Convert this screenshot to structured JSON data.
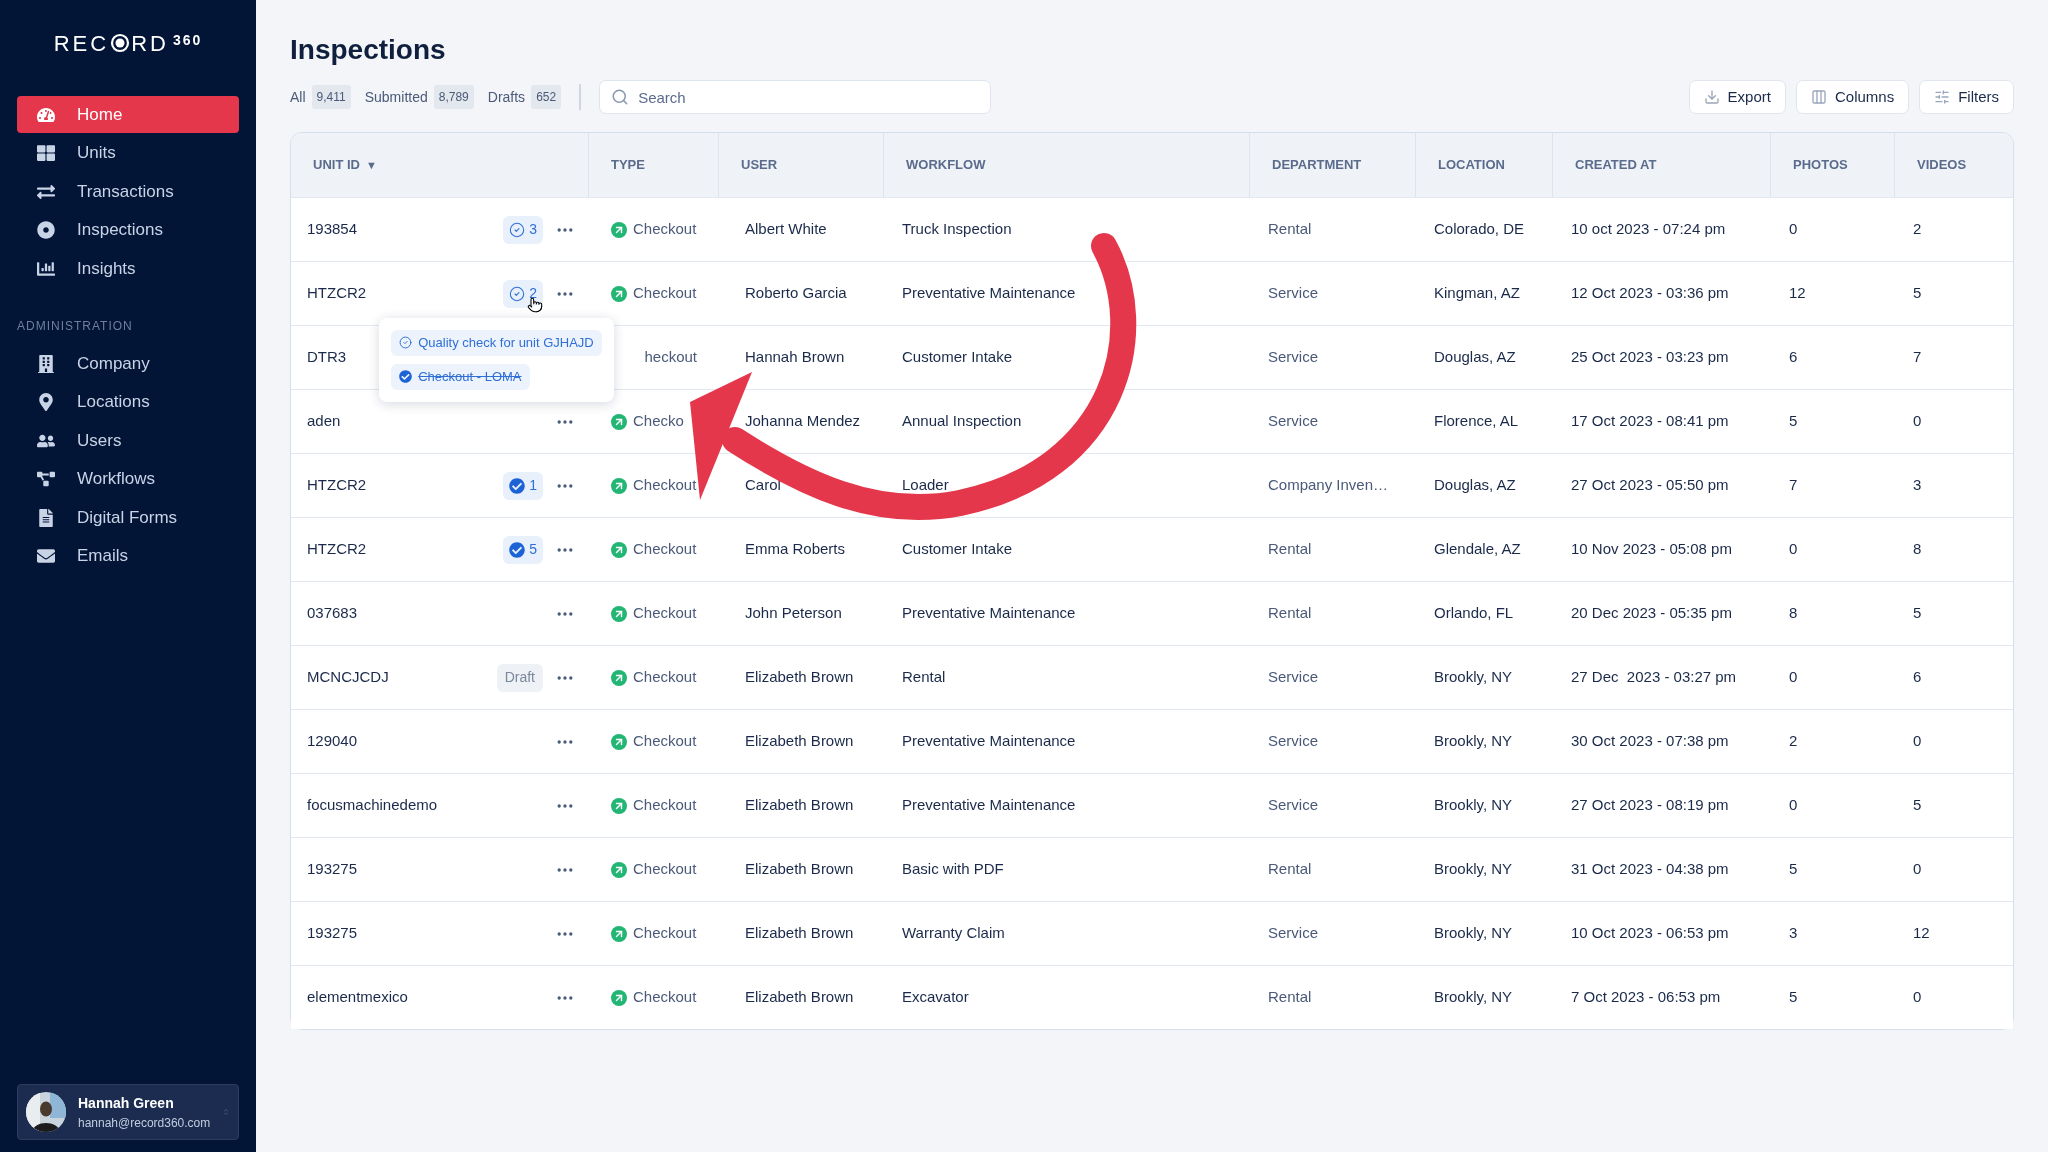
{
  "logo": {
    "left": "REC",
    "right": "RD",
    "suffix": "360"
  },
  "nav": [
    {
      "label": "Home",
      "selected": true
    },
    {
      "label": "Units",
      "selected": false
    },
    {
      "label": "Transactions",
      "selected": false
    },
    {
      "label": "Inspections",
      "selected": false
    },
    {
      "label": "Insights",
      "selected": false
    }
  ],
  "admin": {
    "heading": "ADMINISTRATION",
    "items": [
      {
        "label": "Company",
        "selected": false
      },
      {
        "label": "Locations",
        "selected": false
      },
      {
        "label": "Users",
        "selected": false
      },
      {
        "label": "Workflows",
        "selected": false
      },
      {
        "label": "Digital Forms",
        "selected": false
      },
      {
        "label": "Emails",
        "selected": false
      }
    ]
  },
  "user": {
    "name": "Hannah Green",
    "email": "hannah@record360.com"
  },
  "page_title": "Inspections",
  "filters": [
    {
      "label": "All",
      "count": "9,411"
    },
    {
      "label": "Submitted",
      "count": "8,789"
    },
    {
      "label": "Drafts",
      "count": "652"
    }
  ],
  "search": {
    "placeholder": "Search"
  },
  "actions": [
    "Export",
    "Columns",
    "Filters"
  ],
  "columns": [
    {
      "label": "UNIT ID",
      "sort_mark": "▼"
    },
    {
      "label": "TYPE"
    },
    {
      "label": "USER"
    },
    {
      "label": "WORKFLOW"
    },
    {
      "label": "DEPARTMENT"
    },
    {
      "label": "LOCATION"
    },
    {
      "label": "CREATED AT"
    },
    {
      "label": "PHOTOS"
    },
    {
      "label": "VIDEOS"
    }
  ],
  "rows": [
    {
      "unit": "193854",
      "checks": {
        "count": "3",
        "complete": false
      },
      "type": {
        "label": "Checkout",
        "icon": true
      },
      "user": "Albert White",
      "workflow": "Truck Inspection",
      "department": "Rental",
      "location": "Colorado, DE",
      "created": "10 oct 2023 - 07:24 pm",
      "photos": "0",
      "videos": "2"
    },
    {
      "unit": "HTZCR2",
      "checks": {
        "count": "2",
        "complete": false
      },
      "hovered": true,
      "popover": [
        {
          "label": "Quality check for unit GJHAJD",
          "done": false
        },
        {
          "label": "Checkout - LOMA",
          "done": true
        }
      ],
      "type": {
        "label": "Checkout",
        "icon": true
      },
      "user": "Roberto Garcia",
      "workflow": "Preventative Maintenance",
      "department": "Service",
      "location": "Kingman, AZ",
      "created": "12 Oct 2023 - 03:36 pm",
      "photos": "12",
      "videos": "5"
    },
    {
      "unit": "DTR3",
      "menu": false,
      "type": {
        "label": "heckout",
        "icon": false
      },
      "user": "Hannah Brown",
      "workflow": "Customer Intake",
      "department": "Service",
      "location": "Douglas, AZ",
      "created": "25 Oct 2023 - 03:23 pm",
      "photos": "6",
      "videos": "7"
    },
    {
      "unit": "aden",
      "type": {
        "label": "Checko",
        "icon": true
      },
      "user": "Johanna Mendez",
      "workflow": "Annual Inspection",
      "department": "Service",
      "location": "Florence, AL",
      "created": "17 Oct 2023 - 08:41 pm",
      "photos": "5",
      "videos": "0"
    },
    {
      "unit": "HTZCR2",
      "checks": {
        "count": "1",
        "complete": true
      },
      "type": {
        "label": "Checkout",
        "icon": true
      },
      "user": "Carol",
      "workflow": "Loader",
      "department": "Company Inven…",
      "location": "Douglas, AZ",
      "created": "27 Oct 2023 - 05:50 pm",
      "photos": "7",
      "videos": "3"
    },
    {
      "unit": "HTZCR2",
      "checks": {
        "count": "5",
        "complete": true
      },
      "type": {
        "label": "Checkout",
        "icon": true
      },
      "user": "Emma Roberts",
      "workflow": "Customer Intake",
      "department": "Rental",
      "location": "Glendale, AZ",
      "created": "10 Nov 2023 - 05:08 pm",
      "photos": "0",
      "videos": "8"
    },
    {
      "unit": "037683",
      "type": {
        "label": "Checkout",
        "icon": true
      },
      "user": "John Peterson",
      "workflow": "Preventative Maintenance",
      "department": "Rental",
      "location": "Orlando, FL",
      "created": "20 Dec 2023 - 05:35 pm",
      "photos": "8",
      "videos": "5"
    },
    {
      "unit": "MCNCJCDJ",
      "badge": "Draft",
      "type": {
        "label": "Checkout",
        "icon": true
      },
      "user": "Elizabeth Brown",
      "workflow": "Rental",
      "department": "Service",
      "location": "Brookly, NY",
      "created": "27 Dec  2023 - 03:27 pm",
      "photos": "0",
      "videos": "6"
    },
    {
      "unit": "129040",
      "type": {
        "label": "Checkout",
        "icon": true
      },
      "user": "Elizabeth Brown",
      "workflow": "Preventative Maintenance",
      "department": "Service",
      "location": "Brookly, NY",
      "created": "30 Oct 2023 - 07:38 pm",
      "photos": "2",
      "videos": "0"
    },
    {
      "unit": "focusmachinedemo",
      "type": {
        "label": "Checkout",
        "icon": true
      },
      "user": "Elizabeth Brown",
      "workflow": "Preventative Maintenance",
      "department": "Service",
      "location": "Brookly, NY",
      "created": "27 Oct 2023 - 08:19 pm",
      "photos": "0",
      "videos": "5"
    },
    {
      "unit": "193275",
      "type": {
        "label": "Checkout",
        "icon": true
      },
      "user": "Elizabeth Brown",
      "workflow": "Basic with PDF",
      "department": "Rental",
      "location": "Brookly, NY",
      "created": "31 Oct 2023 - 04:38 pm",
      "photos": "5",
      "videos": "0"
    },
    {
      "unit": "193275",
      "type": {
        "label": "Checkout",
        "icon": true
      },
      "user": "Elizabeth Brown",
      "workflow": "Warranty Claim",
      "department": "Service",
      "location": "Brookly, NY",
      "created": "10 Oct 2023 - 06:53 pm",
      "photos": "3",
      "videos": "12"
    },
    {
      "unit": "elementmexico",
      "type": {
        "label": "Checkout",
        "icon": true
      },
      "user": "Elizabeth Brown",
      "workflow": "Excavator",
      "department": "Rental",
      "location": "Brookly, NY",
      "created": "7 Oct 2023 - 06:53 pm",
      "photos": "5",
      "videos": "0"
    }
  ]
}
